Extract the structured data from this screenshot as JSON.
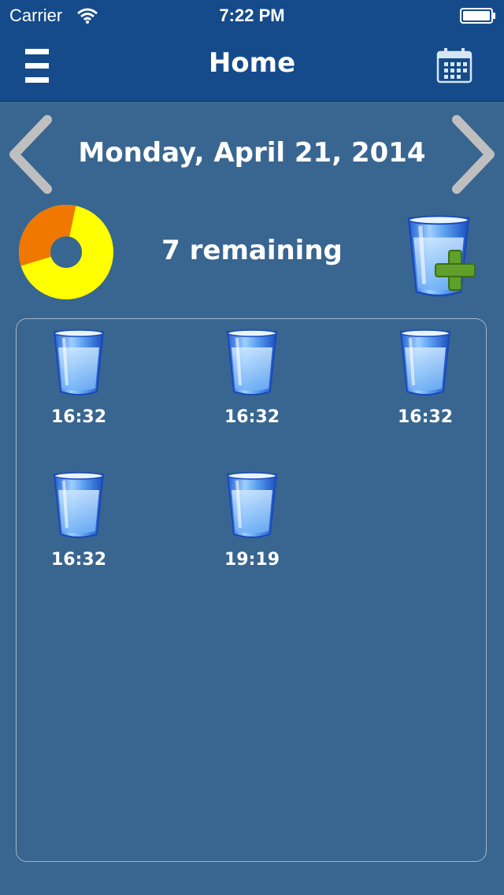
{
  "status_bar": {
    "carrier": "Carrier",
    "time": "7:22 PM"
  },
  "nav": {
    "title": "Home",
    "menu_icon": "hamburger-icon",
    "calendar_icon": "calendar-icon"
  },
  "date": {
    "label": "Monday, April 21, 2014"
  },
  "progress": {
    "consumed_fraction": 0.33,
    "remaining_color": "#ffff00",
    "consumed_color": "#f07800"
  },
  "remaining_text": "7 remaining",
  "glasses": [
    {
      "time": "16:32"
    },
    {
      "time": "16:32"
    },
    {
      "time": "16:32"
    },
    {
      "time": "16:32"
    },
    {
      "time": "19:19"
    }
  ]
}
